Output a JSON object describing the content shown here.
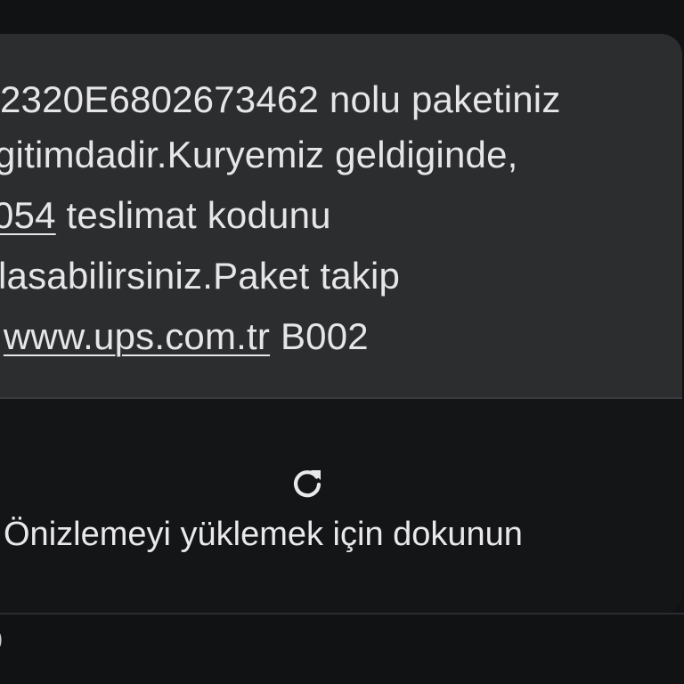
{
  "message": {
    "line1": "2320E6802673462 nolu paketiniz",
    "line2": "gitimdadir.Kuryemiz geldiginde,",
    "line3_code": "054",
    "line3_rest": " teslimat kodunu",
    "line4": "lasabilirsiniz.Paket takip",
    "line5_prefix": ":",
    "line5_link": "www.ups.com.tr",
    "line5_suffix": " B002"
  },
  "preview": {
    "icon": "refresh-icon",
    "label": "Önizlemeyi yüklemek için dokunun"
  },
  "footer": {
    "fragment": "0"
  },
  "colors": {
    "background": "#111214",
    "bubble": "#2c2d2f",
    "text": "#e6e6e8"
  }
}
